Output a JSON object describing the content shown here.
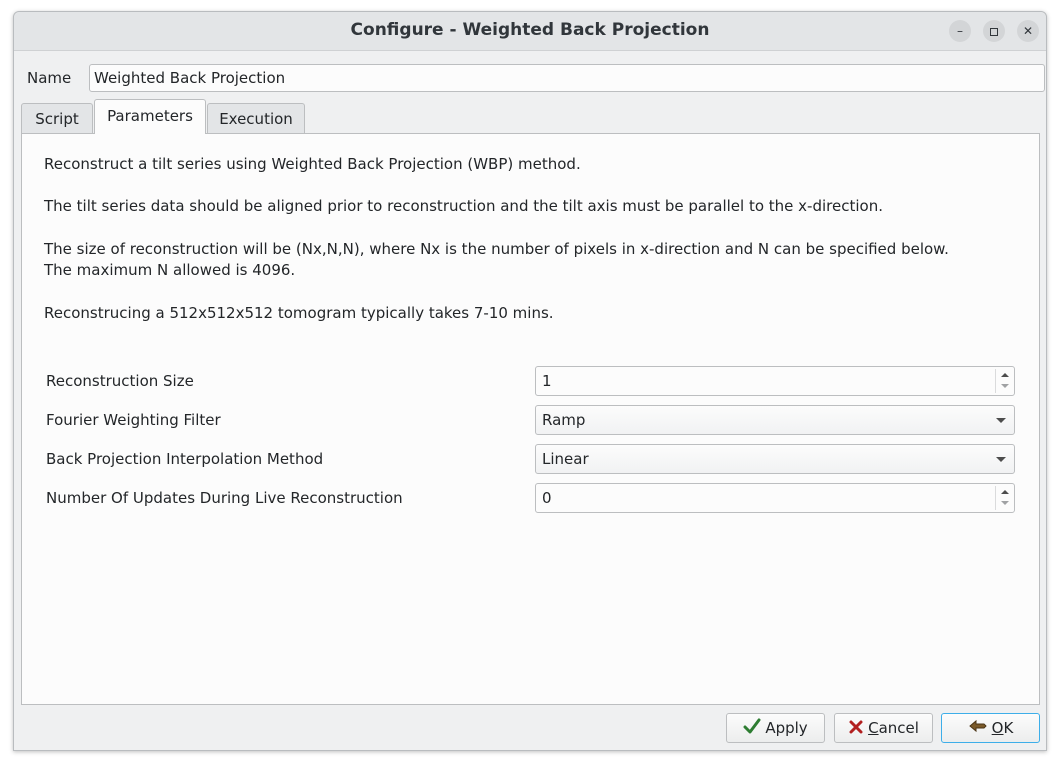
{
  "window": {
    "title": "Configure - Weighted Back Projection",
    "controls": [
      "minimize-icon",
      "maximize-icon",
      "close-icon"
    ]
  },
  "name": {
    "label": "Name",
    "value": "Weighted Back Projection"
  },
  "tabs": [
    {
      "label": "Script",
      "active": false
    },
    {
      "label": "Parameters",
      "active": true
    },
    {
      "label": "Execution",
      "active": false
    }
  ],
  "description": {
    "p1": "Reconstruct a tilt series using Weighted Back Projection (WBP) method.",
    "p2": "The tilt series data should be aligned prior to reconstruction and the tilt axis must be parallel to the x-direction.",
    "p3a": "The size of reconstruction will be (Nx,N,N), where Nx is the number of pixels in x-direction and N can be specified below.",
    "p3b": "The maximum N allowed is 4096.",
    "p4": "Reconstrucing a 512x512x512 tomogram typically takes 7-10 mins."
  },
  "parameters": {
    "reconstruction_size": {
      "label": "Reconstruction Size",
      "value": "1"
    },
    "fourier_filter": {
      "label": "Fourier Weighting Filter",
      "value": "Ramp"
    },
    "interpolation": {
      "label": "Back Projection Interpolation Method",
      "value": "Linear"
    },
    "live_updates": {
      "label": "Number Of Updates During Live Reconstruction",
      "value": "0"
    }
  },
  "buttons": {
    "apply": {
      "label": "Apply",
      "icon": "check-icon"
    },
    "cancel": {
      "mnemonic": "C",
      "rest": "ancel",
      "icon": "cross-icon"
    },
    "ok": {
      "mnemonic": "O",
      "rest": "K",
      "icon": "ok-hand-icon"
    }
  },
  "colors": {
    "accent": "#3daee9",
    "apply_check": "#2e7d32",
    "cancel_x": "#b21f1f"
  }
}
